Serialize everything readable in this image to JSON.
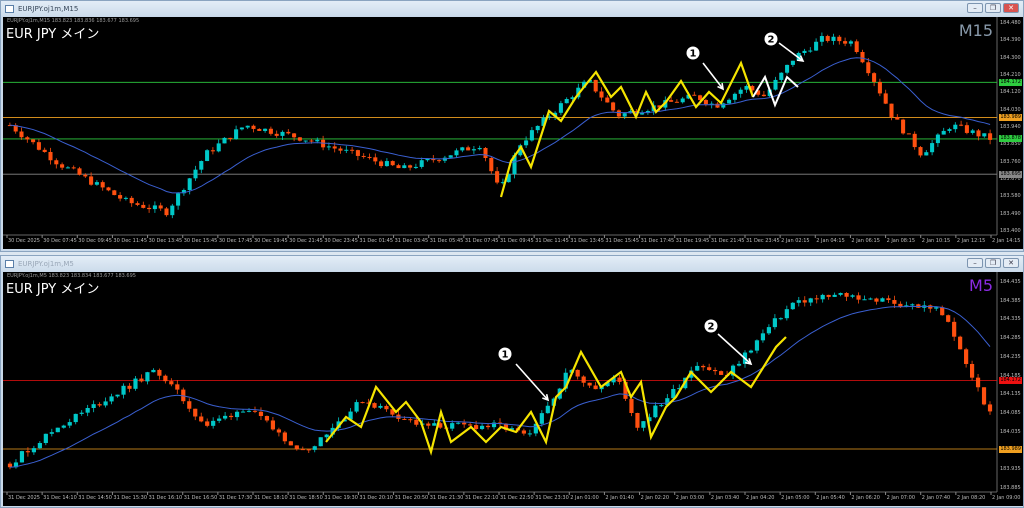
{
  "windows": [
    {
      "title": "EURJPY.oj1m,M15",
      "info": "EURJPY.oj1m,M15  183.823 183.836 183.677 183.695",
      "symbol": "EUR JPY  メイン",
      "timeframe": "M15",
      "timeframe_color": "#8899aa",
      "price_ticks": [
        "184.480",
        "184.390",
        "184.300",
        "184.210",
        "184.120",
        "184.030",
        "183.940",
        "183.850",
        "183.760",
        "183.670",
        "183.580",
        "183.490",
        "183.400"
      ],
      "price_range": [
        183.4,
        184.48
      ],
      "levels": [
        {
          "label": "184.172",
          "price": 184.172,
          "color": "#2ecc40"
        },
        {
          "label": "183.989",
          "price": 183.989,
          "color": "#f0a020"
        },
        {
          "label": "183.878",
          "price": 183.878,
          "color": "#2ecc40"
        },
        {
          "label": "183.695",
          "price": 183.695,
          "color": "#888888"
        }
      ],
      "time_labels": [
        "30 Dec 2025",
        "30 Dec 07:45",
        "30 Dec 09:45",
        "30 Dec 11:45",
        "30 Dec 13:45",
        "30 Dec 15:45",
        "30 Dec 17:45",
        "30 Dec 19:45",
        "30 Dec 21:45",
        "30 Dec 23:45",
        "31 Dec 01:45",
        "31 Dec 03:45",
        "31 Dec 05:45",
        "31 Dec 07:45",
        "31 Dec 09:45",
        "31 Dec 11:45",
        "31 Dec 13:45",
        "31 Dec 15:45",
        "31 Dec 17:45",
        "31 Dec 19:45",
        "31 Dec 21:45",
        "31 Dec 23:45",
        "2 Jan 02:15",
        "2 Jan 04:15",
        "2 Jan 06:15",
        "2 Jan 08:15",
        "2 Jan 10:15",
        "2 Jan 12:15",
        "2 Jan 14:15"
      ],
      "markers": [
        "1",
        "2"
      ]
    },
    {
      "title": "EURJPY.oj1m,M5",
      "info": "EURJPY.oj1m,M5  183.823 183.834 183.677 183.695",
      "symbol": "EUR JPY  メイン",
      "timeframe": "M5",
      "timeframe_color": "#8a2be2",
      "price_ticks": [
        "184.435",
        "184.385",
        "184.335",
        "184.285",
        "184.235",
        "184.185",
        "184.135",
        "184.085",
        "184.035",
        "183.985",
        "183.935",
        "183.885"
      ],
      "price_range": [
        183.885,
        184.445
      ],
      "levels": [
        {
          "label": "184.172",
          "price": 184.172,
          "color": "#ee1111"
        },
        {
          "label": "183.989",
          "price": 183.989,
          "color": "#f0a020"
        }
      ],
      "time_labels": [
        "31 Dec 2025",
        "31 Dec 14:10",
        "31 Dec 14:50",
        "31 Dec 15:30",
        "31 Dec 16:10",
        "31 Dec 16:50",
        "31 Dec 17:30",
        "31 Dec 18:10",
        "31 Dec 18:50",
        "31 Dec 19:30",
        "31 Dec 20:10",
        "31 Dec 20:50",
        "31 Dec 21:30",
        "31 Dec 22:10",
        "31 Dec 22:50",
        "31 Dec 23:30",
        "2 Jan 01:00",
        "2 Jan 01:40",
        "2 Jan 02:20",
        "2 Jan 03:00",
        "2 Jan 03:40",
        "2 Jan 04:20",
        "2 Jan 05:00",
        "2 Jan 05:40",
        "2 Jan 06:20",
        "2 Jan 07:00",
        "2 Jan 07:40",
        "2 Jan 08:20",
        "2 Jan 09:00"
      ],
      "markers": [
        "1",
        "2"
      ]
    }
  ],
  "chart_data": [
    {
      "type": "candlestick",
      "title": "EURJPY M15",
      "trend_keypoints": [
        [
          0,
          183.95
        ],
        [
          0.05,
          183.75
        ],
        [
          0.12,
          183.55
        ],
        [
          0.16,
          183.5
        ],
        [
          0.2,
          183.8
        ],
        [
          0.24,
          183.95
        ],
        [
          0.3,
          183.88
        ],
        [
          0.35,
          183.8
        ],
        [
          0.4,
          183.72
        ],
        [
          0.45,
          183.8
        ],
        [
          0.48,
          183.85
        ],
        [
          0.5,
          183.6
        ],
        [
          0.52,
          183.85
        ],
        [
          0.55,
          184.0
        ],
        [
          0.59,
          184.18
        ],
        [
          0.62,
          184.0
        ],
        [
          0.66,
          184.05
        ],
        [
          0.7,
          184.1
        ],
        [
          0.72,
          184.05
        ],
        [
          0.75,
          184.15
        ],
        [
          0.77,
          184.1
        ],
        [
          0.8,
          184.3
        ],
        [
          0.83,
          184.4
        ],
        [
          0.86,
          184.38
        ],
        [
          0.88,
          184.2
        ],
        [
          0.9,
          184.0
        ],
        [
          0.93,
          183.8
        ],
        [
          0.96,
          183.95
        ],
        [
          1,
          183.88
        ]
      ],
      "candles": 170,
      "up_color": "#00c8c8",
      "down_color": "#ff5010",
      "ma_color": "#3a5fd0"
    },
    {
      "type": "candlestick",
      "title": "EURJPY M5",
      "trend_keypoints": [
        [
          0,
          183.95
        ],
        [
          0.05,
          184.05
        ],
        [
          0.15,
          184.2
        ],
        [
          0.2,
          184.05
        ],
        [
          0.24,
          184.1
        ],
        [
          0.3,
          183.98
        ],
        [
          0.33,
          184.05
        ],
        [
          0.36,
          184.12
        ],
        [
          0.42,
          184.05
        ],
        [
          0.5,
          184.05
        ],
        [
          0.53,
          184.02
        ],
        [
          0.57,
          184.2
        ],
        [
          0.6,
          184.15
        ],
        [
          0.62,
          184.18
        ],
        [
          0.64,
          184.05
        ],
        [
          0.68,
          184.15
        ],
        [
          0.7,
          184.22
        ],
        [
          0.73,
          184.18
        ],
        [
          0.77,
          184.3
        ],
        [
          0.8,
          184.38
        ],
        [
          0.85,
          184.4
        ],
        [
          0.9,
          184.38
        ],
        [
          0.95,
          184.36
        ],
        [
          1,
          184.08
        ]
      ],
      "candles": 165,
      "up_color": "#00c8c8",
      "down_color": "#ff5010",
      "ma_color": "#3a5fd0"
    }
  ]
}
